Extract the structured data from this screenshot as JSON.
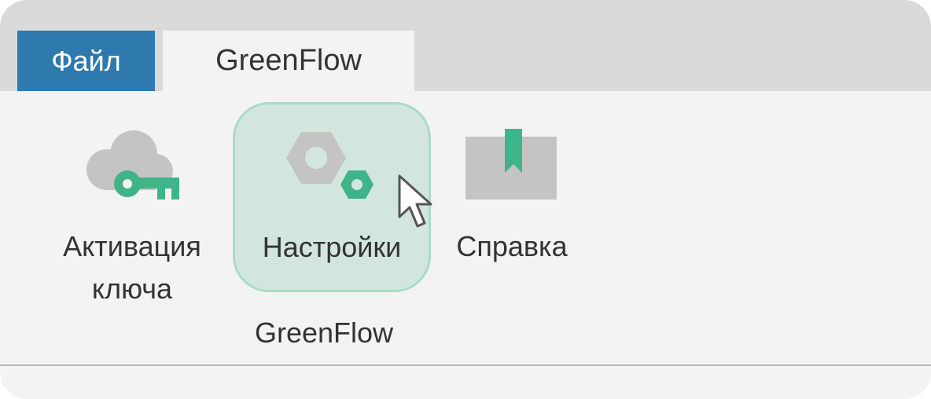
{
  "tabs": {
    "file_label": "Файл",
    "greenflow_label": "GreenFlow"
  },
  "ribbon": {
    "buttons": [
      {
        "label_line1": "Активация",
        "label_line2": "ключа",
        "icon": "cloud-key-icon"
      },
      {
        "label": "Настройки",
        "icon": "settings-nuts-icon",
        "state": "hovered"
      },
      {
        "label": "Справка",
        "icon": "book-bookmark-icon"
      }
    ],
    "group_label": "GreenFlow"
  },
  "colors": {
    "file_tab": "#2e79ae",
    "accent_green": "#3fb489",
    "icon_gray": "#c4c4c4",
    "hover_bg": "#d3e6de",
    "hover_border": "#a8dcc7"
  }
}
